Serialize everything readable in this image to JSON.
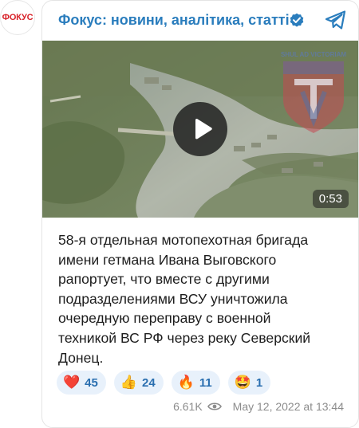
{
  "avatar": {
    "text": "ФОКУС"
  },
  "channel": {
    "title": "Фокус: новини, аналітика, статті",
    "verified_icon": "verified-badge-icon",
    "app_icon": "telegram-icon"
  },
  "video": {
    "duration": "0:53",
    "overlay_logo_text": "SHUL AD VICTORIAM"
  },
  "post": {
    "lines": [
      "58-я отдельная мотопехотная бригада",
      "имени гетмана Ивана Выговского",
      "рапортует, что вместе с другими",
      "подразделениями ВСУ уничтожила",
      "очередную переправу с военной",
      "техникой ВС РФ через реку Северский",
      "Донец."
    ]
  },
  "reactions": [
    {
      "emoji": "❤️",
      "count": "45"
    },
    {
      "emoji": "👍",
      "count": "24"
    },
    {
      "emoji": "🔥",
      "count": "11"
    },
    {
      "emoji": "🤩",
      "count": "1"
    }
  ],
  "meta": {
    "views": "6.61K",
    "date": "May 12, 2022 at 13:44"
  },
  "colors": {
    "title": "#2a7dbd",
    "reaction_bg": "#e8f1fb",
    "reaction_count": "#2a6fb0",
    "meta": "#8c8c8c",
    "avatar_text": "#d8232a"
  }
}
